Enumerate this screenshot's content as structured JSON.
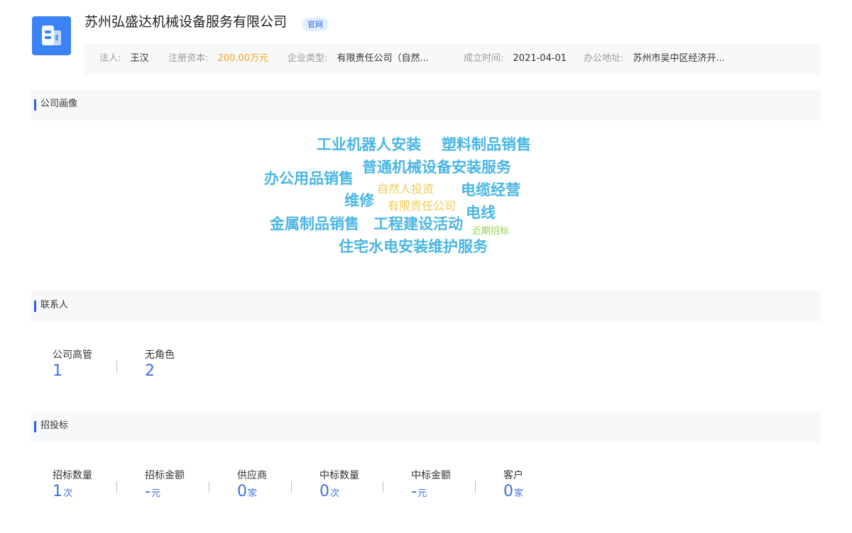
{
  "company": {
    "name": "苏州弘盛达机械设备服务有限公司",
    "official_tag": "官网",
    "logo_icon": "building-icon"
  },
  "info": {
    "legal_label": "法人:",
    "legal_value": "王汉",
    "capital_label": "注册资本:",
    "capital_value": "200.00万元",
    "type_label": "企业类型:",
    "type_value": "有限责任公司（自然...",
    "founded_label": "成立时间:",
    "founded_value": "2021-04-01",
    "address_label": "办公地址:",
    "address_value": "苏州市吴中区经济开..."
  },
  "sections": {
    "profile": "公司画像",
    "contacts": "联系人",
    "bidding": "招投标"
  },
  "word_cloud": [
    "工业机器人安装",
    "塑料制品销售",
    "普通机械设备安装服务",
    "办公用品销售",
    "自然人投资",
    "电缆经营",
    "维修",
    "有限责任公司",
    "电线",
    "金属制品销售",
    "工程建设活动",
    "近期招标",
    "住宅水电安装维护服务"
  ],
  "contacts": [
    {
      "label": "公司高管",
      "value": "1"
    },
    {
      "label": "无角色",
      "value": "2"
    }
  ],
  "bidding": [
    {
      "label": "招标数量",
      "value": "1",
      "unit": "次"
    },
    {
      "label": "招标金额",
      "value": "-",
      "unit": "元"
    },
    {
      "label": "供应商",
      "value": "0",
      "unit": "家"
    },
    {
      "label": "中标数量",
      "value": "0",
      "unit": "次"
    },
    {
      "label": "中标金额",
      "value": "-",
      "unit": "元"
    },
    {
      "label": "客户",
      "value": "0",
      "unit": "家"
    }
  ],
  "colors": {
    "accent": "#2563eb",
    "money": "#f5a623",
    "cloud_blue": "#4ab6e3",
    "cloud_yellow": "#f2c94c",
    "cloud_green": "#8fd14f"
  }
}
